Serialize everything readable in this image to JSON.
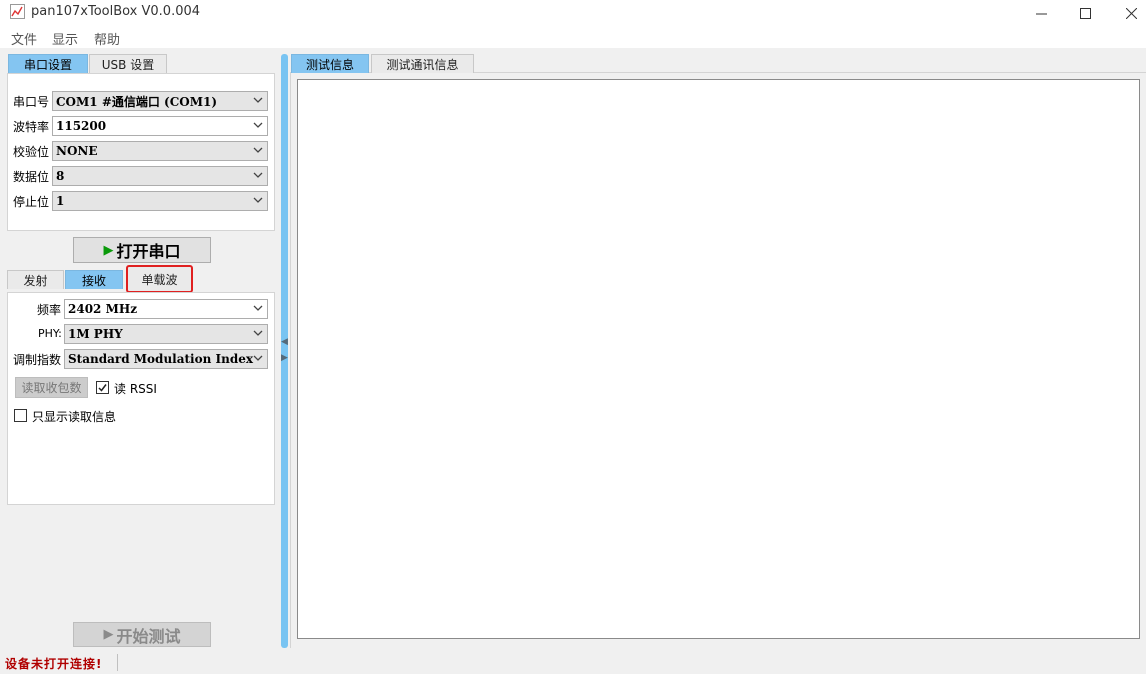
{
  "window": {
    "title": "pan107xToolBox V0.0.004"
  },
  "menu": {
    "file": "文件",
    "view": "显示",
    "help": "帮助"
  },
  "left_tabs": {
    "serial": "串口设置",
    "usb": "USB 设置"
  },
  "serial": {
    "port_label": "串口号",
    "port_value": "COM1 #通信端口 (COM1)",
    "baud_label": "波特率",
    "baud_value": "115200",
    "parity_label": "校验位",
    "parity_value": "NONE",
    "databits_label": "数据位",
    "databits_value": "8",
    "stopbits_label": "停止位",
    "stopbits_value": "1"
  },
  "open_port_button": "打开串口",
  "sub_tabs": {
    "transmit": "发射",
    "receive": "接收",
    "carrier": "单载波"
  },
  "receive": {
    "freq_label": "频率",
    "freq_value": "2402 MHz",
    "phy_label": "PHY:",
    "phy_value": "1M PHY",
    "mod_label": "调制指数",
    "mod_value": "Standard Modulation Index",
    "read_count_button": "读取收包数",
    "read_rssi_label": "读 RSSI",
    "read_rssi_checked": true,
    "only_read_label": "只显示读取信息",
    "only_read_checked": false
  },
  "start_test_button": "开始测试",
  "right_tabs": {
    "test_info": "测试信息",
    "comm_info": "测试通讯信息"
  },
  "status": {
    "message": "设备未打开连接!"
  },
  "colors": {
    "active_tab": "#84c5f1",
    "splitter": "#79c4f2",
    "status_error": "#b00000",
    "highlight_border": "#e02020"
  }
}
